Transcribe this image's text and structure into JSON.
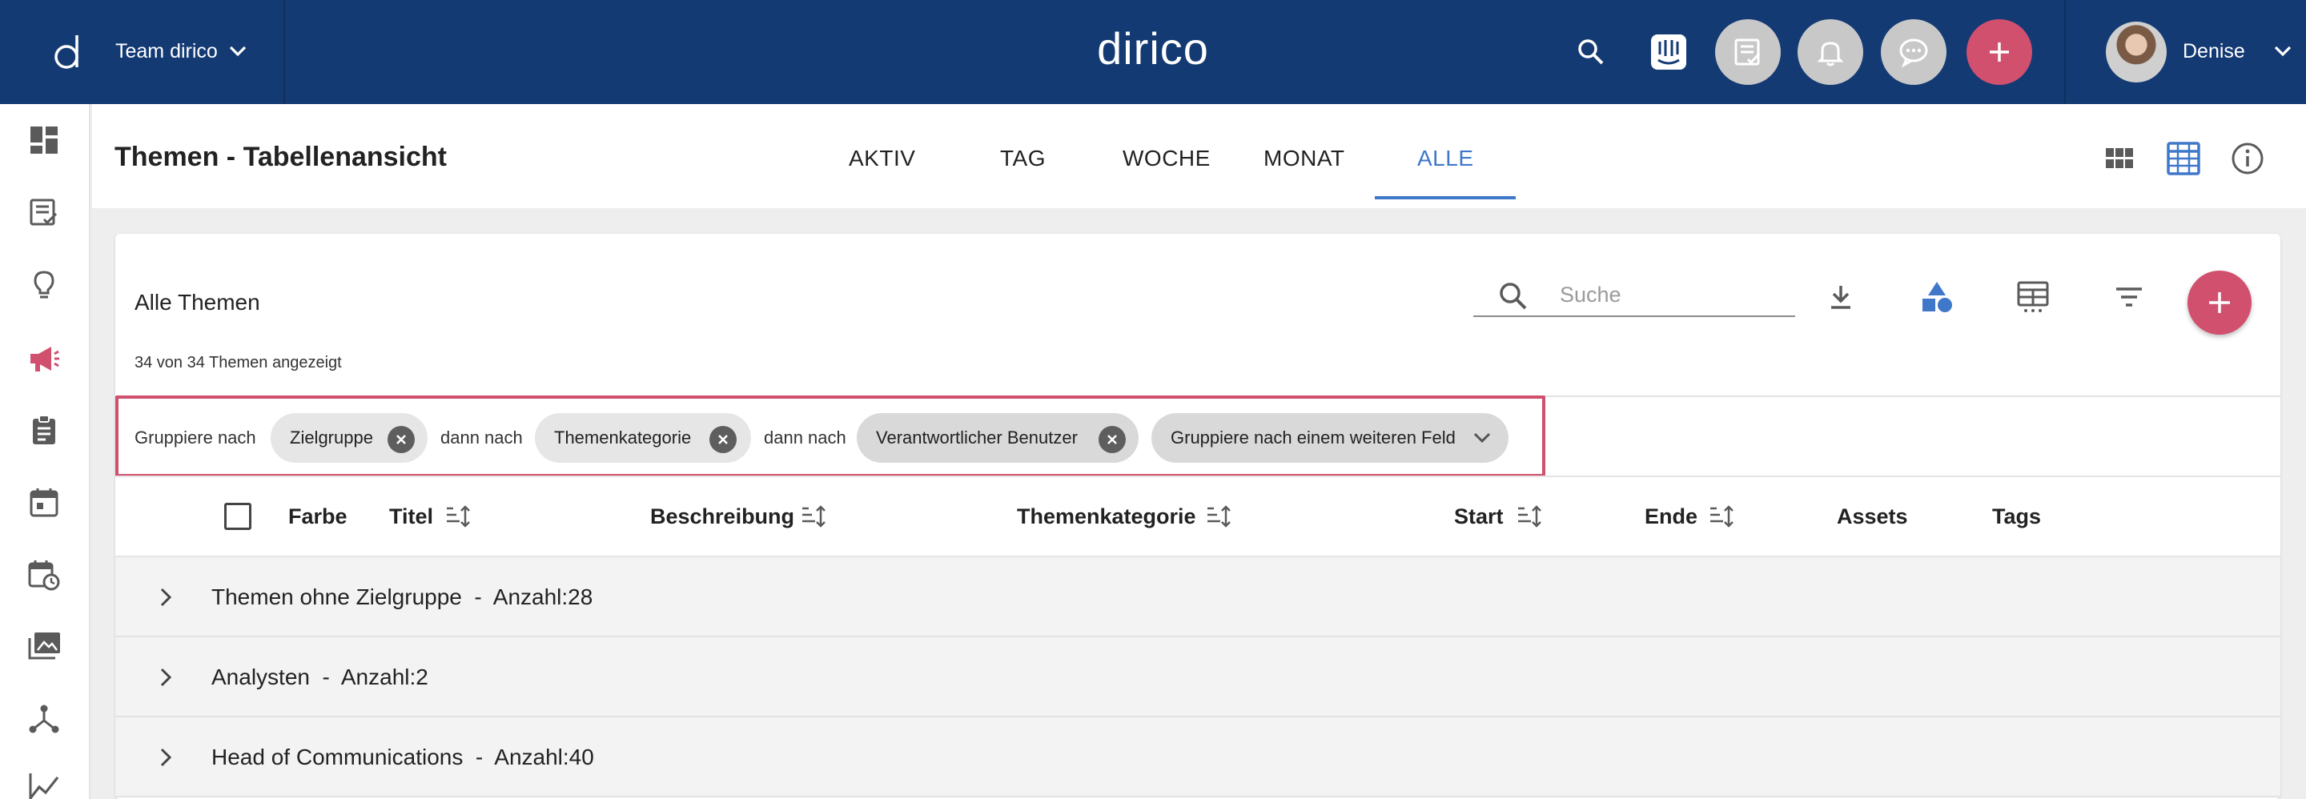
{
  "header": {
    "team_name": "Team dirico",
    "brand": "dirico",
    "user_name": "Denise",
    "icons": [
      "search-icon",
      "intercom-icon",
      "tasks-icon",
      "bell-icon",
      "chat-icon",
      "add-icon"
    ],
    "colors": {
      "header_bg": "#143a73",
      "accent": "#d0506e",
      "active_tab": "#3f78c9"
    }
  },
  "sidebar": {
    "items": [
      "dashboard-icon",
      "checklist-icon",
      "lightbulb-icon",
      "megaphone-icon",
      "clipboard-icon",
      "calendar-icon",
      "schedule-icon",
      "gallery-icon",
      "network-icon",
      "chart-icon"
    ],
    "active": "megaphone-icon"
  },
  "subheader": {
    "title": "Themen - Tabellenansicht",
    "tabs": [
      {
        "label": "AKTIV"
      },
      {
        "label": "TAG"
      },
      {
        "label": "WOCHE"
      },
      {
        "label": "MONAT"
      },
      {
        "label": "ALLE"
      }
    ],
    "active_tab": "ALLE"
  },
  "card": {
    "title": "Alle Themen",
    "count_text": "34 von 34 Themen angezeigt",
    "search_placeholder": "Suche",
    "grouping": {
      "label_start": "Gruppiere nach",
      "label_then": "dann nach",
      "chips": [
        "Zielgruppe",
        "Themenkategorie",
        "Verantwortlicher Benutzer"
      ],
      "add_chip": "Gruppiere nach einem weiteren Feld"
    },
    "columns": [
      "Farbe",
      "Titel",
      "Beschreibung",
      "Themenkategorie",
      "Start",
      "Ende",
      "Assets",
      "Tags"
    ],
    "groups": [
      {
        "name": "Themen ohne Zielgruppe",
        "count_label": "Anzahl:28"
      },
      {
        "name": "Analysten",
        "count_label": "Anzahl:2"
      },
      {
        "name": "Head of Communications",
        "count_label": "Anzahl:40"
      }
    ]
  }
}
